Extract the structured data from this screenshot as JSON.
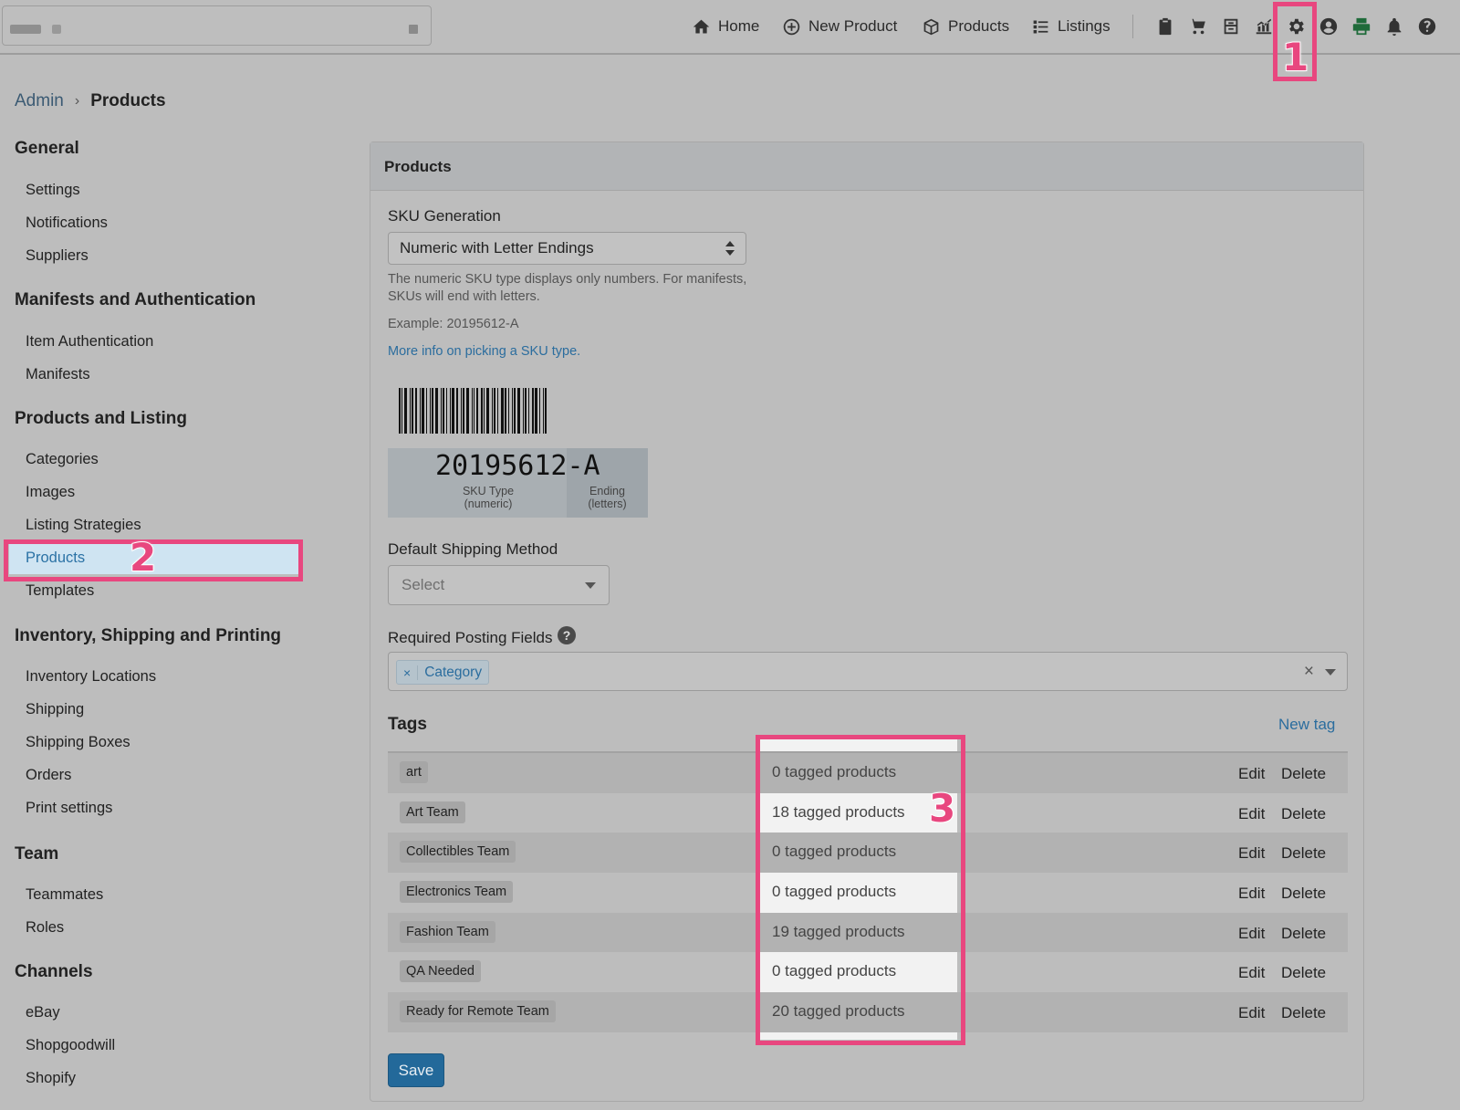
{
  "nav": {
    "links": [
      {
        "label": "Home",
        "icon": "home-icon"
      },
      {
        "label": "New Product",
        "icon": "plus-circle-icon"
      },
      {
        "label": "Products",
        "icon": "box-icon"
      },
      {
        "label": "Listings",
        "icon": "list-icon"
      }
    ],
    "tools": [
      "clipboard-icon",
      "cart-icon",
      "archive-icon",
      "chart-icon",
      "gear-icon",
      "user-circle-icon",
      "printer-icon",
      "bell-icon",
      "question-icon"
    ]
  },
  "annotations": [
    "1",
    "2",
    "3"
  ],
  "breadcrumb": {
    "parent": "Admin",
    "separator": "›",
    "current": "Products"
  },
  "sidebar": {
    "groups": [
      {
        "title": "General",
        "items": [
          "Settings",
          "Notifications",
          "Suppliers"
        ]
      },
      {
        "title": "Manifests and Authentication",
        "items": [
          "Item Authentication",
          "Manifests"
        ]
      },
      {
        "title": "Products and Listing",
        "items": [
          "Categories",
          "Images",
          "Listing Strategies",
          "Products",
          "Templates"
        ]
      },
      {
        "title": "Inventory, Shipping and Printing",
        "items": [
          "Inventory Locations",
          "Shipping",
          "Shipping Boxes",
          "Orders",
          "Print settings"
        ]
      },
      {
        "title": "Team",
        "items": [
          "Teammates",
          "Roles"
        ]
      },
      {
        "title": "Channels",
        "items": [
          "eBay",
          "Shopgoodwill",
          "Shopify"
        ]
      }
    ],
    "active_item": "Products"
  },
  "card": {
    "title": "Products",
    "sku": {
      "label": "SKU Generation",
      "value": "Numeric with Letter Endings",
      "help_line1": "The numeric SKU type displays only numbers. For manifests,",
      "help_line2": "SKUs will end with letters.",
      "example": "Example: 20195612-A",
      "more_info": "More info on picking a SKU type.",
      "preview_number": "20195612-A",
      "caption_type_1": "SKU Type",
      "caption_type_2": "(numeric)",
      "caption_end_1": "Ending",
      "caption_end_2": "(letters)"
    },
    "shipping": {
      "label": "Default Shipping Method",
      "placeholder": "Select"
    },
    "required_fields": {
      "label": "Required Posting Fields",
      "help": "?",
      "chips": [
        "Category"
      ],
      "chip_remove": "×",
      "clear": "×"
    },
    "tags": {
      "title": "Tags",
      "new_tag": "New tag",
      "edit_label": "Edit",
      "delete_label": "Delete",
      "rows": [
        {
          "name": "art",
          "count": "0 tagged products"
        },
        {
          "name": "Art Team",
          "count": "18 tagged products"
        },
        {
          "name": "Collectibles Team",
          "count": "0 tagged products"
        },
        {
          "name": "Electronics Team",
          "count": "0 tagged products"
        },
        {
          "name": "Fashion Team",
          "count": "19 tagged products"
        },
        {
          "name": "QA Needed",
          "count": "0 tagged products"
        },
        {
          "name": "Ready for Remote Team",
          "count": "20 tagged products"
        }
      ]
    },
    "save_label": "Save"
  },
  "colors": {
    "accent": "#2b6d9e",
    "annotation": "#e8477f",
    "save_button": "#23699a"
  }
}
